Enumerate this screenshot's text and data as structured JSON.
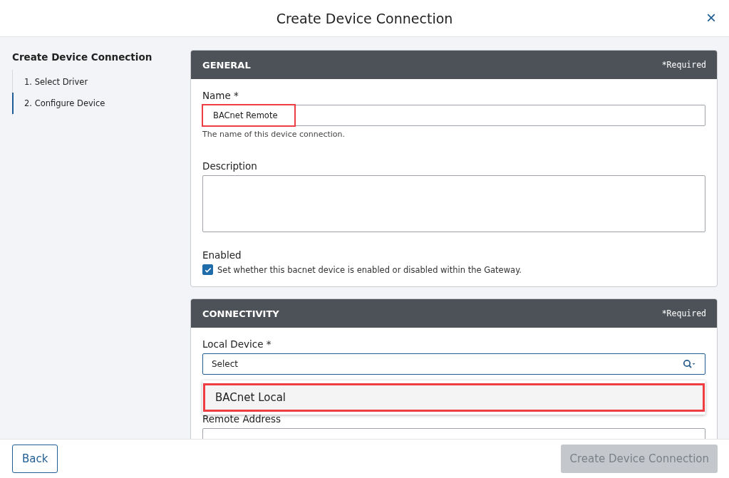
{
  "window": {
    "title": "Create Device Connection",
    "close": "×"
  },
  "sidebar": {
    "title": "Create Device Connection",
    "steps": [
      {
        "label": "1. Select Driver",
        "selected": false
      },
      {
        "label": "2. Configure Device",
        "selected": true
      }
    ]
  },
  "general": {
    "title": "GENERAL",
    "required": "*Required",
    "name": {
      "label": "Name *",
      "value": "BACnet Remote",
      "help": "The name of this device connection.",
      "annotated": true
    },
    "description": {
      "label": "Description"
    },
    "enabled": {
      "label": "Enabled",
      "text": "Set whether this bacnet device is enabled or disabled within the Gateway.",
      "checked": true
    }
  },
  "connectivity": {
    "title": "CONNECTIVITY",
    "required": "*Required",
    "local_device": {
      "label": "Local Device *",
      "placeholder": "Select",
      "options": [
        {
          "label": "BACnet Local",
          "annotated": true
        }
      ]
    },
    "remote_address": {
      "label": "Remote Address"
    }
  },
  "footer": {
    "back": "Back",
    "create": {
      "label": "Create Device Connection",
      "disabled": true
    }
  }
}
